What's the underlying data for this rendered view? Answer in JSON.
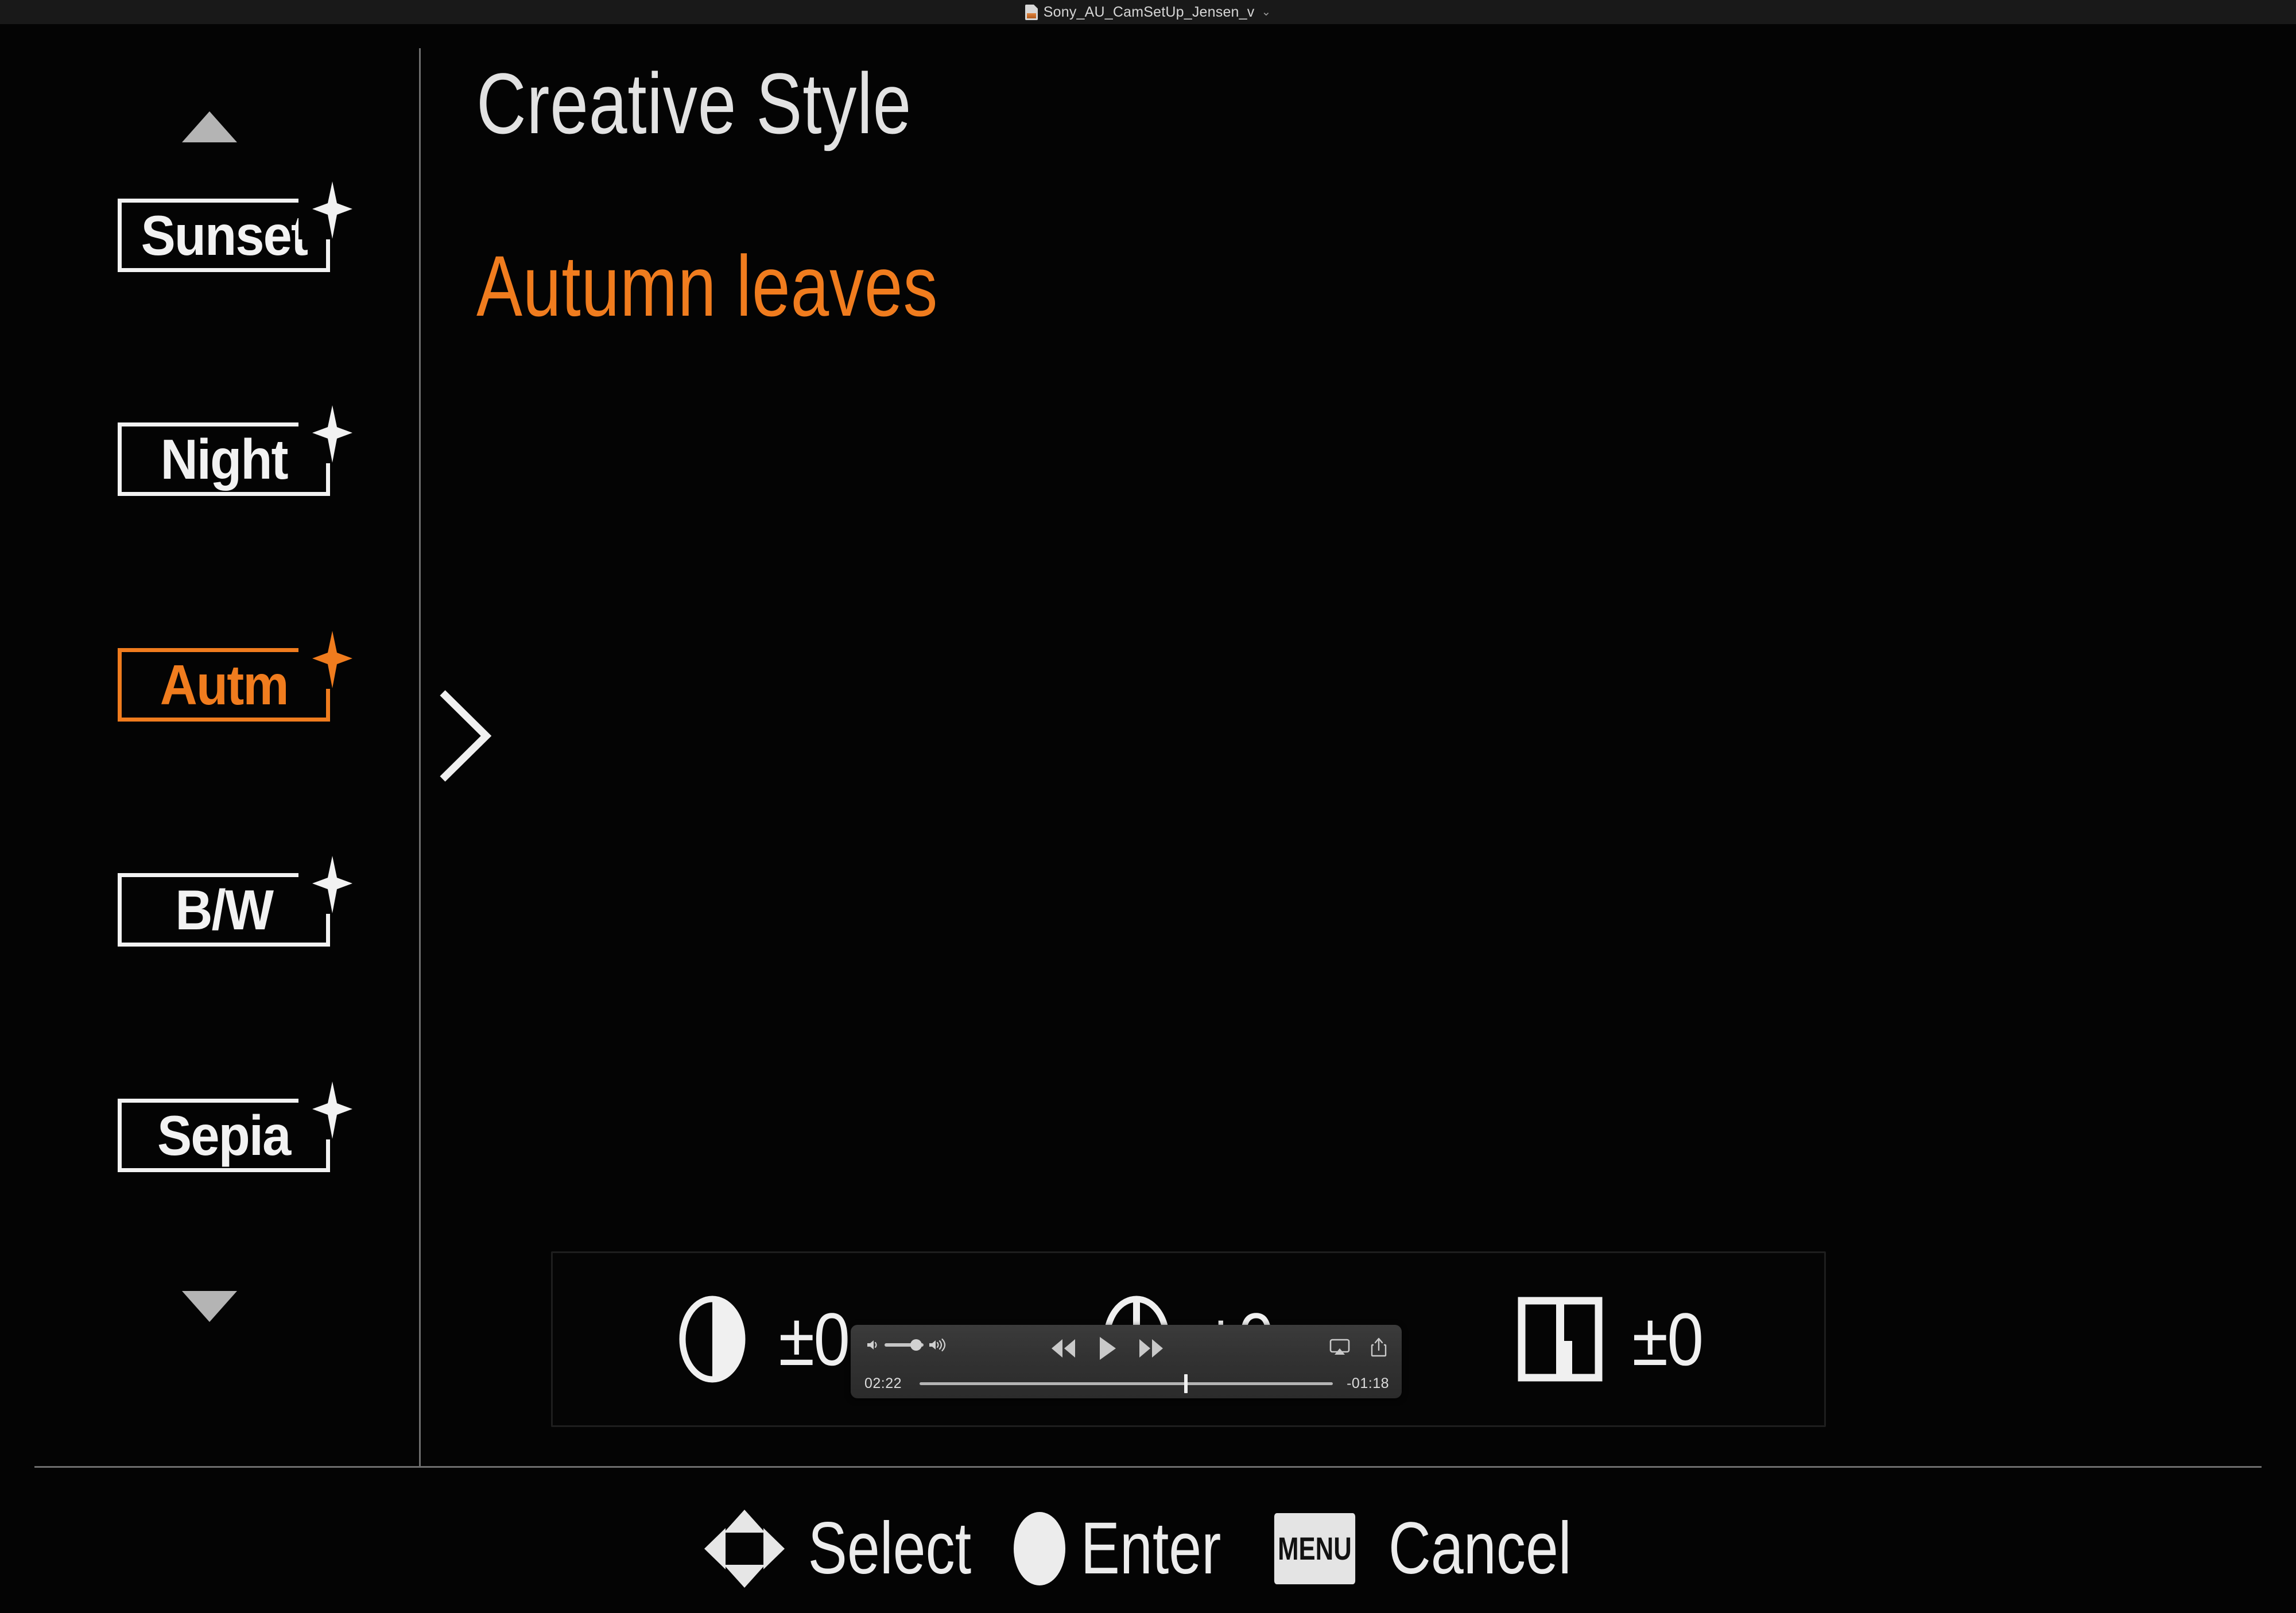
{
  "titlebar": {
    "document_icon": "document-icon",
    "filename": "Sony_AU_CamSetUp_Jensen_v",
    "chevron": "⌄"
  },
  "colors": {
    "accent_orange": "#f07c1e",
    "text_white": "#ececec",
    "screen_bg": "#040404",
    "divider": "#6e6e6e",
    "player_bg": "#323232"
  },
  "sidebar": {
    "scroll_up_icon": "triangle-up-icon",
    "scroll_down_icon": "triangle-down-icon",
    "items": [
      {
        "label": "Sunset",
        "selected": false,
        "sparkle": true
      },
      {
        "label": "Night",
        "selected": false,
        "sparkle": true
      },
      {
        "label": "Autm",
        "selected": true,
        "sparkle": true
      },
      {
        "label": "B/W",
        "selected": false,
        "sparkle": true
      },
      {
        "label": "Sepia",
        "selected": false,
        "sparkle": true
      }
    ]
  },
  "main": {
    "title": "Creative Style",
    "selected_value": "Autumn leaves",
    "expand_icon": "chevron-right-icon"
  },
  "parameters": [
    {
      "icon": "contrast-icon",
      "name": "Contrast",
      "value": "±0"
    },
    {
      "icon": "saturation-icon",
      "name": "Saturation",
      "value": "±0"
    },
    {
      "icon": "sharpness-icon",
      "name": "Sharpness",
      "value": "±0"
    }
  ],
  "hintbar": {
    "dpad_icon": "dpad-icon",
    "select_label": "Select",
    "enter_icon": "circle-button-icon",
    "enter_label": "Enter",
    "menu_badge": "MENU",
    "cancel_label": "Cancel"
  },
  "player": {
    "volume_low_icon": "volume-low-icon",
    "volume_high_icon": "volume-high-icon",
    "rewind_icon": "rewind-icon",
    "play_icon": "play-icon",
    "forward_icon": "fast-forward-icon",
    "airplay_icon": "airplay-icon",
    "share_icon": "share-icon",
    "elapsed": "02:22",
    "remaining": "-01:18",
    "progress_percent": 64,
    "volume_percent": 66
  }
}
